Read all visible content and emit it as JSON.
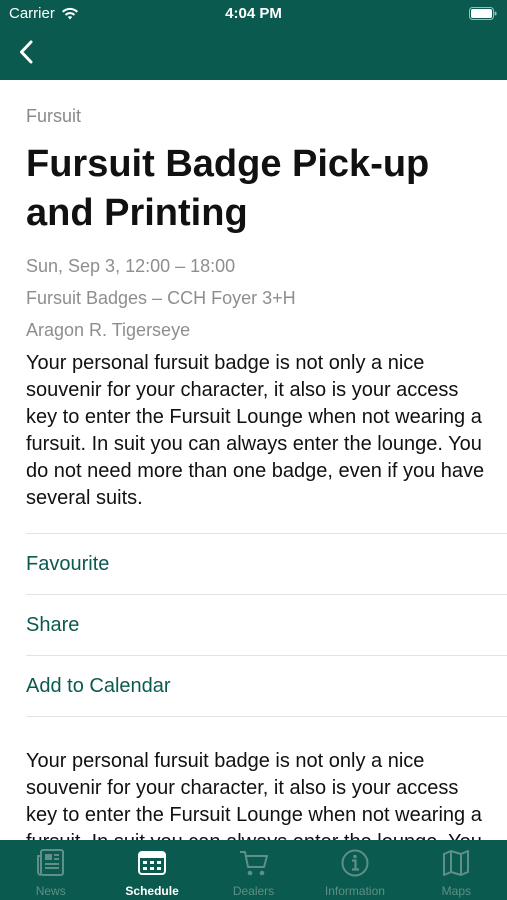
{
  "status_bar": {
    "carrier": "Carrier",
    "time": "4:04 PM"
  },
  "nav": {
    "back_icon": "chevron-left-icon"
  },
  "event": {
    "category": "Fursuit",
    "title": "Fursuit Badge Pick-up and Printing",
    "date": "Sun, Sep 3, 12:00 – 18:00",
    "room": "Fursuit Badges – CCH Foyer 3+H",
    "host": "Aragon R. Tigerseye",
    "description": "Your personal fursuit badge is not only a nice souvenir for your character, it also is your access key to enter the Fursuit Lounge when not wearing a fursuit. In suit you can always enter the lounge. You do not need more than one badge, even if you have several suits."
  },
  "actions": {
    "favourite": "Favourite",
    "share": "Share",
    "add_to_calendar": "Add to Calendar"
  },
  "tabs": {
    "news": "News",
    "schedule": "Schedule",
    "dealers": "Dealers",
    "information": "Information",
    "maps": "Maps",
    "active": "schedule"
  },
  "colors": {
    "brand": "#0b5a4f",
    "accent_text": "#0b5a4f",
    "tab_inactive": "#5f8f86"
  }
}
